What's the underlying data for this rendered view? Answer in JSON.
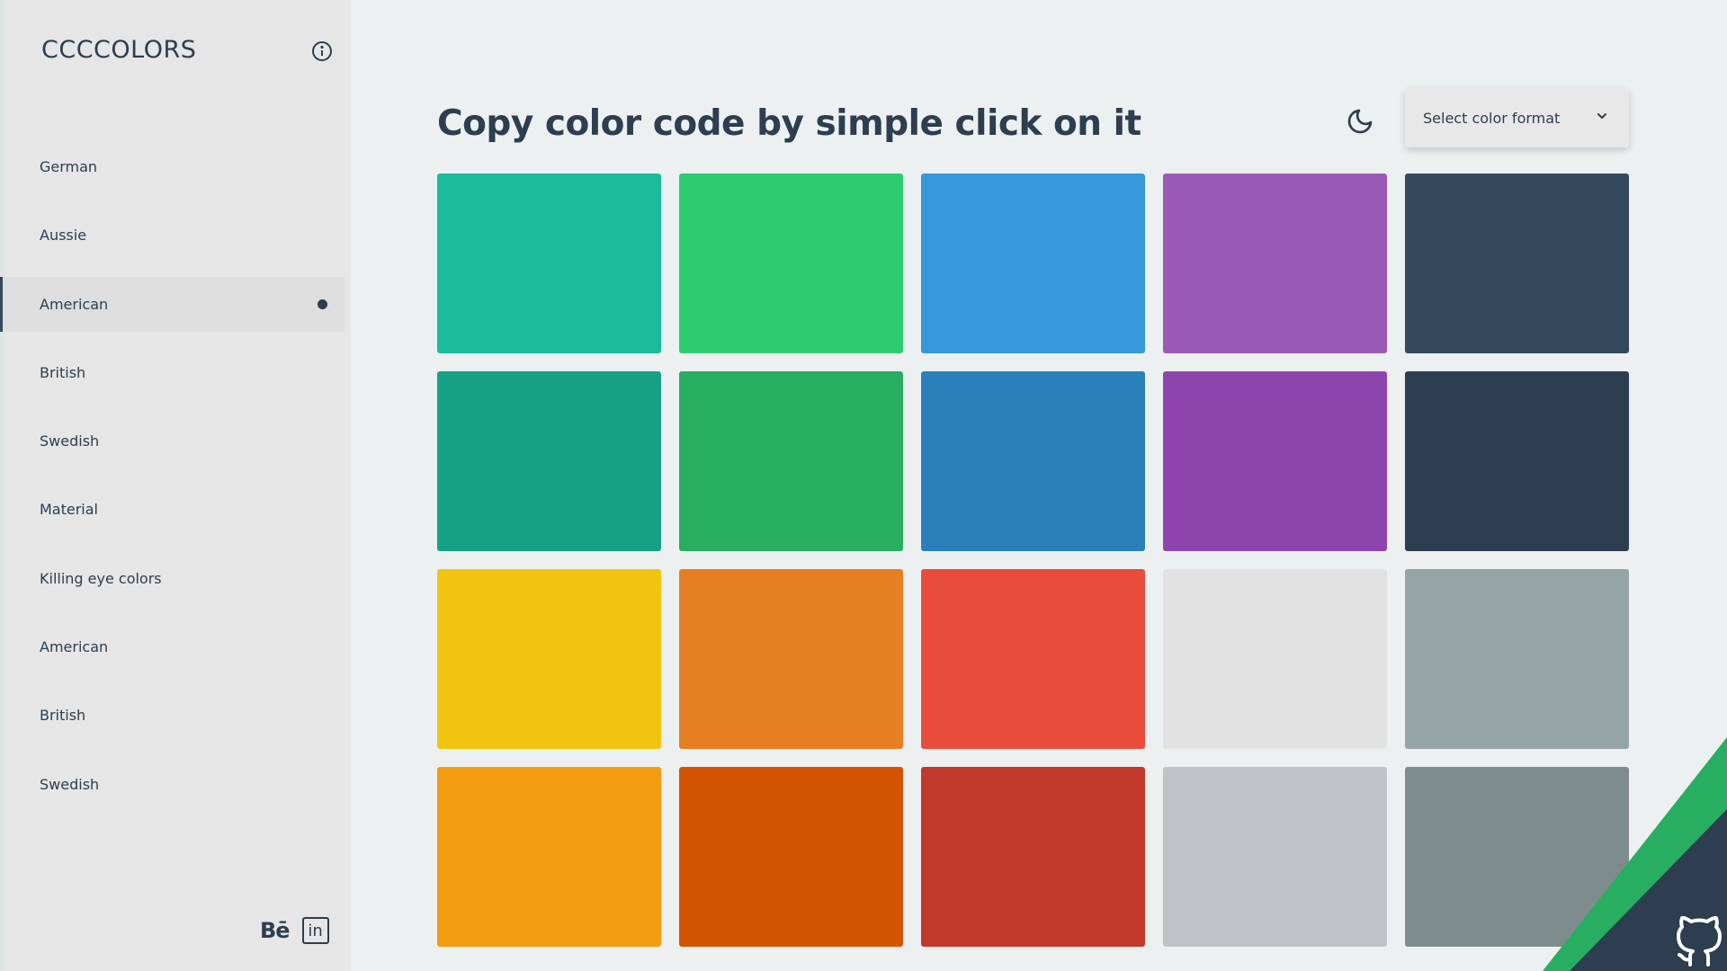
{
  "app": {
    "brand": "CCCCOLORS"
  },
  "sidebar": {
    "items": [
      {
        "label": "German",
        "active": false
      },
      {
        "label": "Aussie",
        "active": false
      },
      {
        "label": "American",
        "active": true
      },
      {
        "label": "British",
        "active": false
      },
      {
        "label": "Swedish",
        "active": false
      },
      {
        "label": "Material",
        "active": false
      },
      {
        "label": "Killing eye colors",
        "active": false
      },
      {
        "label": "American",
        "active": false
      },
      {
        "label": "British",
        "active": false
      },
      {
        "label": "Swedish",
        "active": false
      }
    ],
    "social": {
      "behance": "Bē",
      "linkedin": "in"
    }
  },
  "header": {
    "title": "Copy color code by simple click on it",
    "format_select": {
      "label": "Select color format"
    }
  },
  "palette": {
    "colors": [
      "#1abc9c",
      "#2ecc71",
      "#3498db",
      "#9b59b6",
      "#34495e",
      "#16a085",
      "#27ae60",
      "#2980b9",
      "#8e44ad",
      "#2c3e50",
      "#f1c40f",
      "#e67e22",
      "#e74c3c",
      "#e2e2e2",
      "#95a5a6",
      "#f39c12",
      "#d35400",
      "#c0392b",
      "#bdc3c7",
      "#7f8c8d"
    ]
  },
  "icons": {
    "info": "info-icon",
    "moon": "moon-icon",
    "chevron": "chevron-down-icon",
    "github": "github-icon"
  },
  "theme": {
    "text": "#2c3e50",
    "corner_green": "#27ae60",
    "corner_dark": "#2c3e50"
  }
}
